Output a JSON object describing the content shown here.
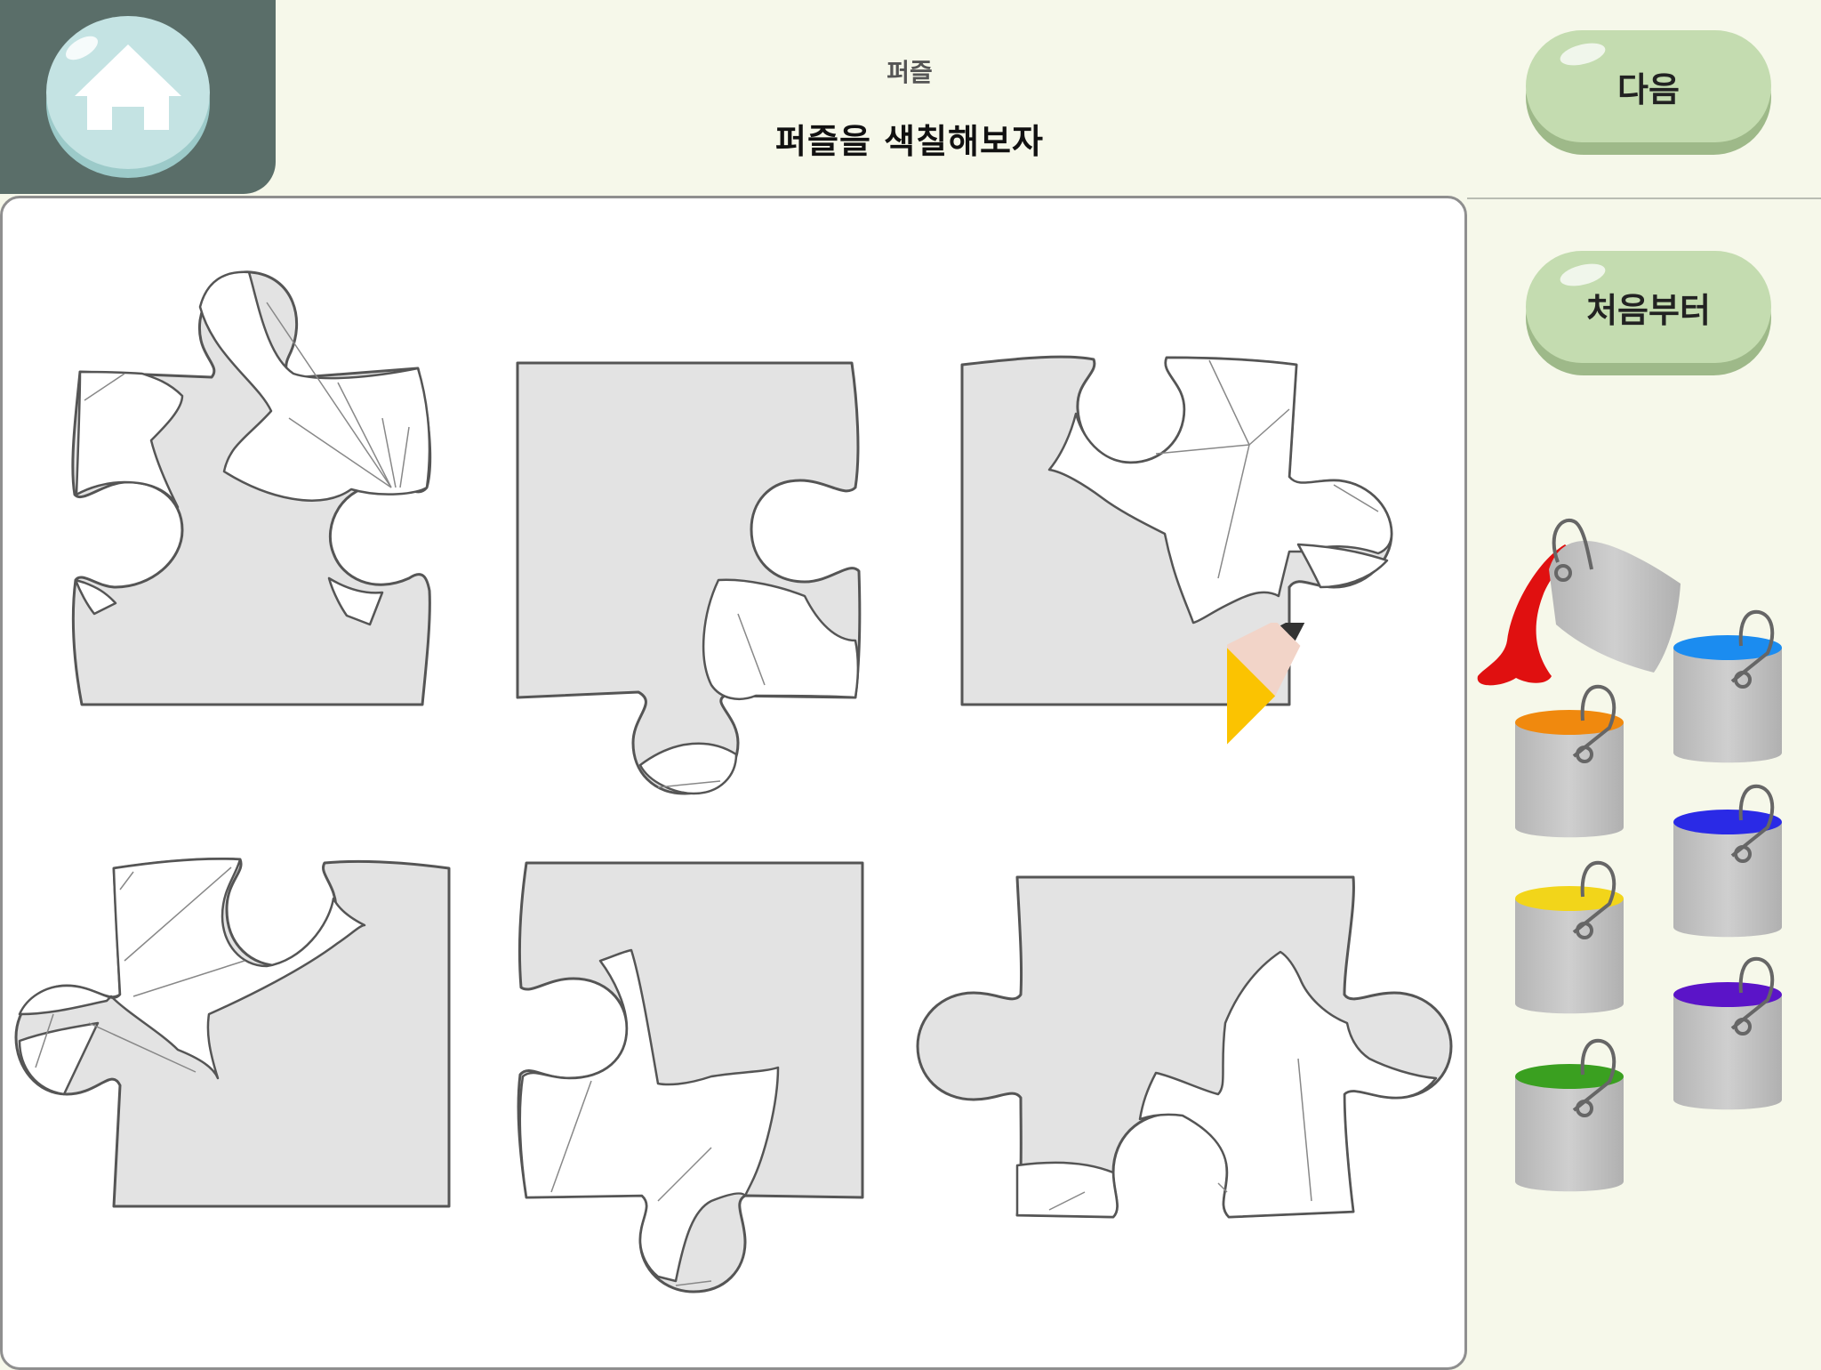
{
  "header": {
    "subtitle": "퍼즐",
    "title": "퍼즐을 색칠해보자"
  },
  "buttons": {
    "next_label": "다음",
    "restart_label": "처음부터",
    "home_icon": "home-icon"
  },
  "paint_buckets": [
    {
      "name": "red",
      "color": "#e01010",
      "state": "pouring"
    },
    {
      "name": "orange",
      "color": "#f0890e"
    },
    {
      "name": "yellow",
      "color": "#f2d51a"
    },
    {
      "name": "green",
      "color": "#3aa020"
    },
    {
      "name": "sky-blue",
      "color": "#1b8cf0"
    },
    {
      "name": "blue",
      "color": "#2a2ae6"
    },
    {
      "name": "purple",
      "color": "#5b14c8"
    }
  ],
  "colors": {
    "home_panel": "#5a6e69",
    "home_button": "#c4e3e3",
    "button_face": "#c4dcb0",
    "background": "#f6f8ea",
    "piece_fill": "#e3e3e3",
    "pencil_body": "#fbc301",
    "pencil_eraser": "#fb6b8e"
  }
}
